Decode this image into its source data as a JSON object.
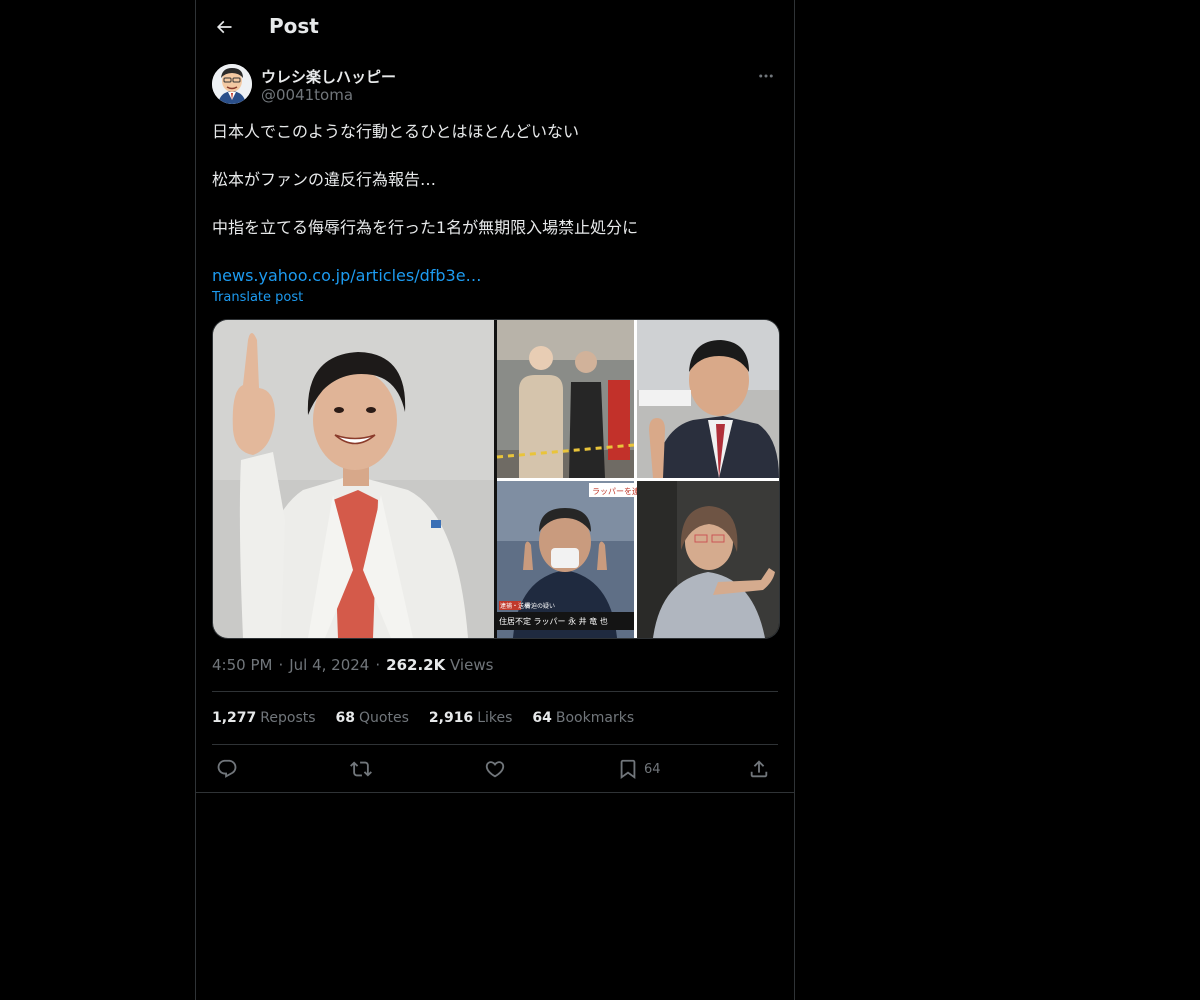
{
  "header": {
    "title": "Post",
    "back_icon": "arrow-left-icon"
  },
  "author": {
    "display_name": "ウレシ楽しハッピー",
    "handle": "@0041toma",
    "avatar_icon": "cartoon-avatar"
  },
  "tweet": {
    "lines": [
      "日本人でこのような行動とるひとはほとんどいない",
      "松本がファンの違反行為報告…",
      "中指を立てる侮辱行為を行った1名が無期限入場禁止処分に"
    ],
    "link": "news.yahoo.co.jp/articles/dfb3e…",
    "translate_label": "Translate post"
  },
  "media": {
    "caption_bottom_left": "住居不定 ラッパー 永 井 竜 也",
    "tag_top_right": "ラッパーを逮",
    "tag_red": "逮捕・送検",
    "tag_small": "脅迫の疑い"
  },
  "meta": {
    "time": "4:50 PM",
    "date": "Jul 4, 2024",
    "views_count": "262.2K",
    "views_label": "Views"
  },
  "stats": {
    "reposts_count": "1,277",
    "reposts_label": "Reposts",
    "quotes_count": "68",
    "quotes_label": "Quotes",
    "likes_count": "2,916",
    "likes_label": "Likes",
    "bookmarks_count": "64",
    "bookmarks_label": "Bookmarks"
  },
  "actions": {
    "bookmark_count": "64"
  },
  "colors": {
    "background": "#000000",
    "text": "#e7e9ea",
    "muted": "#71767b",
    "link": "#1d9bf0",
    "border": "#2f3336"
  }
}
